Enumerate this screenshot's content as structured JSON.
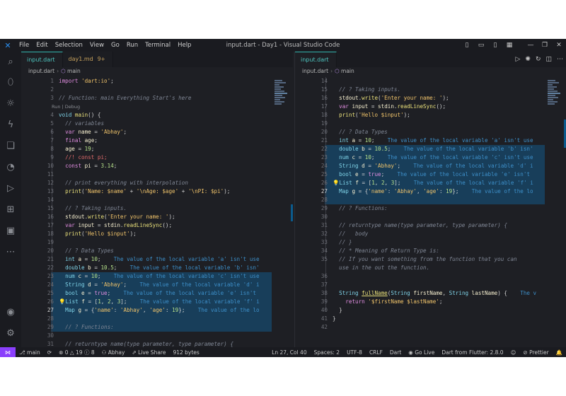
{
  "titlebar": {
    "menu": [
      "File",
      "Edit",
      "Selection",
      "View",
      "Go",
      "Run",
      "Terminal",
      "Help"
    ],
    "title": "input.dart - Day1 - Visual Studio Code"
  },
  "left_editor": {
    "tabs": [
      {
        "label": "input.dart",
        "active": true
      },
      {
        "label": "day1.md",
        "badge": "9+"
      }
    ],
    "breadcrumb": {
      "file": "input.dart",
      "symbol": "main"
    }
  },
  "right_editor": {
    "tabs": [
      {
        "label": "input.dart",
        "active": true
      }
    ],
    "breadcrumb": {
      "file": "input.dart",
      "symbol": "main"
    }
  },
  "codelens": "Run | Debug",
  "statusbar": {
    "branch": "main",
    "problems": "⊗ 0 △ 19 ⓘ 8",
    "user": "Abhay",
    "live_share": "Live Share",
    "size": "912 bytes",
    "position": "Ln 27, Col 40",
    "spaces": "Spaces: 2",
    "encoding": "UTF-8",
    "eol": "CRLF",
    "language": "Dart",
    "go_live": "Go Live",
    "flutter": "Dart from Flutter: 2.8.0",
    "prettier": "Prettier"
  },
  "colors": {
    "accent": "#34b7b0",
    "remote": "#8a3ffc",
    "line_highlight": "#183e5a"
  },
  "icons": [
    "vscode-logo",
    "explorer-icon",
    "search-icon",
    "source-control-icon",
    "run-debug-icon",
    "extensions-icon",
    "remote-explorer-icon",
    "testing-icon",
    "accounts-icon",
    "settings-gear-icon"
  ]
}
